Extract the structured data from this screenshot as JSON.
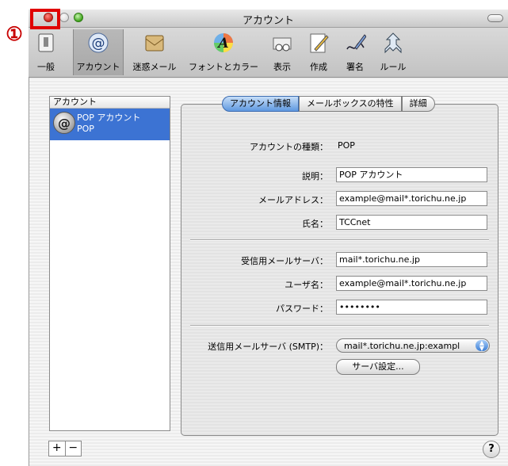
{
  "annotation": {
    "marker": "①"
  },
  "window": {
    "title": "アカウント"
  },
  "toolbar": {
    "items": [
      {
        "label": "一般",
        "icon": "general-switch-icon"
      },
      {
        "label": "アカウント",
        "icon": "at-sign-icon"
      },
      {
        "label": "迷惑メール",
        "icon": "junk-mail-icon"
      },
      {
        "label": "フォントとカラー",
        "icon": "fonts-colors-icon"
      },
      {
        "label": "表示",
        "icon": "viewing-icon"
      },
      {
        "label": "作成",
        "icon": "composing-icon"
      },
      {
        "label": "署名",
        "icon": "signature-icon"
      },
      {
        "label": "ルール",
        "icon": "rules-icon"
      }
    ]
  },
  "accounts": {
    "header": "アカウント",
    "items": [
      {
        "name": "POP アカウント",
        "type": "POP"
      }
    ]
  },
  "tabs": [
    "アカウント情報",
    "メールボックスの特性",
    "詳細"
  ],
  "form": {
    "account_type_label": "アカウントの種類：",
    "account_type_value": "POP",
    "description_label": "説明：",
    "description_value": "POP アカウント",
    "email_label": "メールアドレス：",
    "email_value": "example@mail*.torichu.ne.jp",
    "fullname_label": "氏名：",
    "fullname_value": "TCCnet",
    "incoming_label": "受信用メールサーバ：",
    "incoming_value": "mail*.torichu.ne.jp",
    "username_label": "ユーザ名：",
    "username_value": "example@mail*.torichu.ne.jp",
    "password_label": "パスワード：",
    "password_value": "••••••••",
    "smtp_label": "送信用メールサーバ (SMTP)：",
    "smtp_value": "mail*.torichu.ne.jp:exampl",
    "server_settings_button": "サーバ設定..."
  },
  "footer": {
    "add": "+",
    "remove": "−",
    "help": "?"
  },
  "colors": {
    "highlight": "#e00000",
    "selection": "#3c73d3"
  }
}
